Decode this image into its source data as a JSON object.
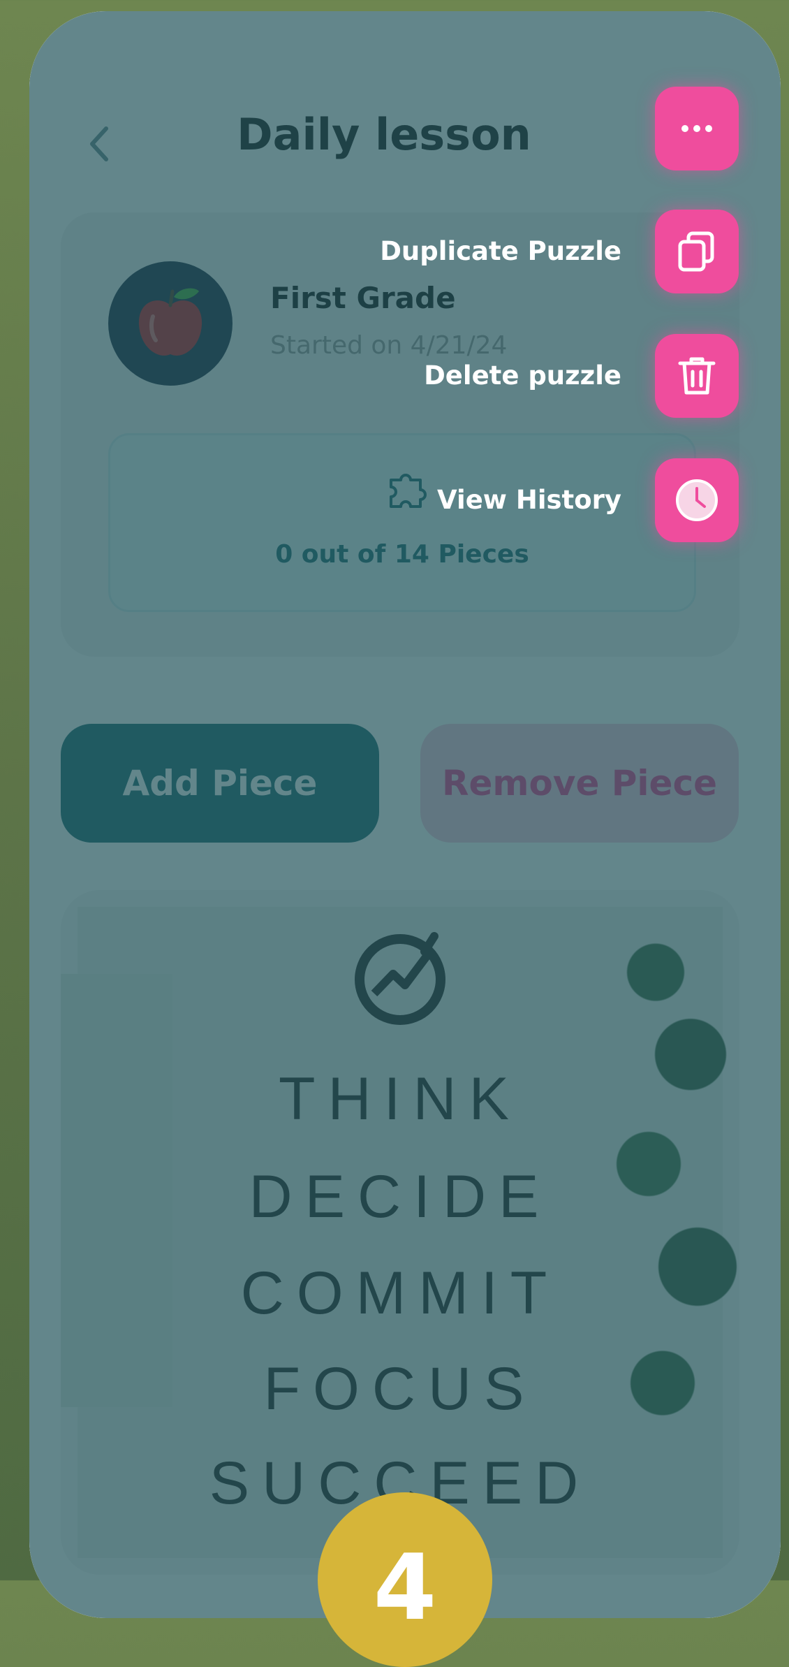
{
  "header": {
    "title": "Daily lesson"
  },
  "card": {
    "grade": "First Grade",
    "started": "Started on 4/21/24",
    "progress": "0 out of 14 Pieces"
  },
  "actions": {
    "add_label": "Add Piece",
    "remove_label": "Remove Piece"
  },
  "poster": {
    "words": [
      "THINK",
      "DECIDE",
      "COMMIT",
      "FOCUS",
      "SUCCEED"
    ]
  },
  "menu": {
    "items": [
      {
        "label": "Duplicate Puzzle",
        "icon": "copy-icon"
      },
      {
        "label": "Delete puzzle",
        "icon": "trash-icon"
      },
      {
        "label": "View History",
        "icon": "clock-icon"
      }
    ],
    "toggle_icon": "more-icon"
  },
  "step_badge": "4",
  "colors": {
    "accent_pink": "#ef4d9d",
    "teal": "#1f6b74",
    "badge": "#d6b539"
  }
}
